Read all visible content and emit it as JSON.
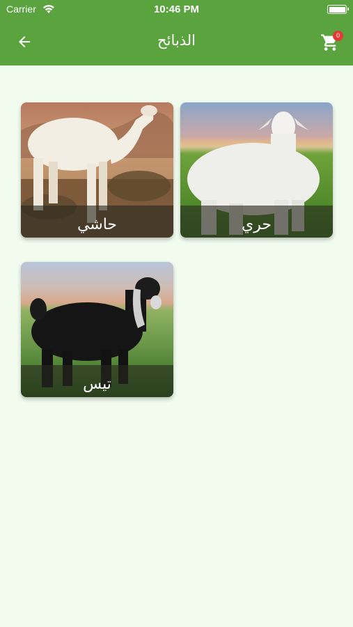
{
  "status_bar": {
    "carrier": "Carrier",
    "time": "10:46 PM"
  },
  "app_bar": {
    "title": "الذبائح",
    "cart_count": "0"
  },
  "categories": [
    {
      "label": "حاشي",
      "image": "white-camel-desert"
    },
    {
      "label": "حري",
      "image": "white-sheep-grass"
    },
    {
      "label": "تيس",
      "image": "black-goat-grass"
    }
  ],
  "colors": {
    "app_bar": "#5aa33f",
    "background": "#f1fcef",
    "badge": "#e53935"
  }
}
